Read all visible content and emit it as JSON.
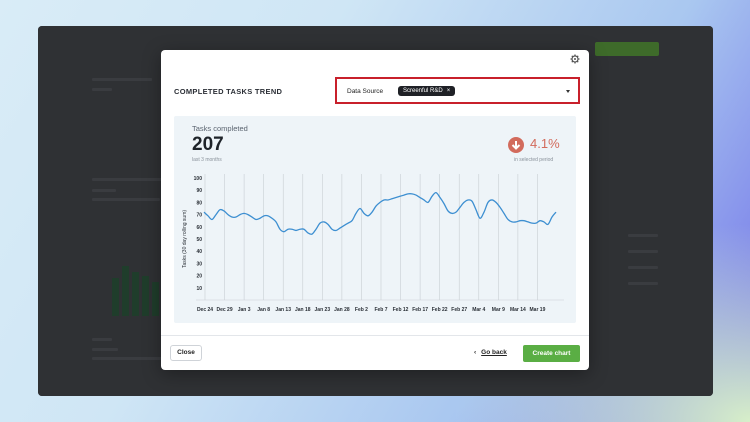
{
  "modal": {
    "title": "COMPLETED TASKS TREND",
    "data_source_label": "Data Source",
    "data_source_value": "Screenful R&D",
    "chip_remove": "×",
    "settings_icon": "gear-icon",
    "summary": {
      "subtitle": "Tasks completed",
      "value": "207",
      "period": "last 3 months",
      "trend_value": "4.1%",
      "trend_direction": "down",
      "trend_period": "in selected period",
      "trend_color": "#d26b5c"
    },
    "footer": {
      "close_label": "Close",
      "back_label": "Go back",
      "create_label": "Create chart",
      "create_color": "#5aae44"
    }
  },
  "chart_data": {
    "type": "line",
    "ylabel": "Tasks (30 day rolling sum)",
    "ylim": [
      0,
      100
    ],
    "yticks": [
      10,
      20,
      30,
      40,
      50,
      60,
      70,
      80,
      90,
      100
    ],
    "xticks": [
      "Dec 24",
      "Dec 29",
      "Jan 3",
      "Jan 8",
      "Jan 13",
      "Jan 18",
      "Jan 23",
      "Jan 28",
      "Feb 2",
      "Feb 7",
      "Feb 12",
      "Feb 17",
      "Feb 22",
      "Feb 27",
      "Mar 4",
      "Mar 9",
      "Mar 14",
      "Mar 19"
    ],
    "grid": "vertical",
    "line_color": "#3d8fd1",
    "series": [
      {
        "x": [
          0,
          1,
          2,
          3,
          4,
          5,
          6,
          7,
          8,
          9,
          10,
          11,
          12,
          13,
          14,
          15,
          16,
          17,
          18,
          19,
          20,
          21,
          22,
          23,
          24,
          25,
          26,
          27,
          28,
          29,
          30,
          31,
          32,
          33,
          34,
          35,
          36,
          37,
          38,
          39,
          40,
          41,
          42,
          43,
          44,
          45,
          46,
          47,
          48,
          49,
          50,
          51,
          52,
          53,
          54,
          55,
          56,
          57,
          58,
          59,
          60,
          61,
          62,
          63,
          64,
          65,
          66,
          67,
          68,
          69,
          70,
          71,
          72,
          73,
          74,
          75,
          76,
          77,
          78,
          79,
          80,
          81,
          82,
          83,
          84,
          85,
          86,
          87,
          88
        ],
        "values": [
          72,
          69,
          66,
          70,
          74,
          73,
          70,
          68,
          68,
          70,
          71,
          70,
          68,
          66,
          67,
          69,
          69,
          67,
          64,
          58,
          56,
          58,
          58,
          57,
          58,
          58,
          55,
          54,
          58,
          63,
          64,
          62,
          58,
          57,
          59,
          61,
          63,
          65,
          71,
          75,
          71,
          69,
          72,
          77,
          80,
          82,
          82,
          83,
          84,
          85,
          86,
          87,
          87,
          86,
          84,
          82,
          80,
          85,
          88,
          84,
          79,
          73,
          71,
          72,
          76,
          80,
          82,
          81,
          74,
          67,
          72,
          80,
          82,
          80,
          76,
          71,
          66,
          64,
          64,
          65,
          65,
          64,
          63,
          63,
          65,
          64,
          62,
          68,
          72
        ]
      }
    ]
  }
}
